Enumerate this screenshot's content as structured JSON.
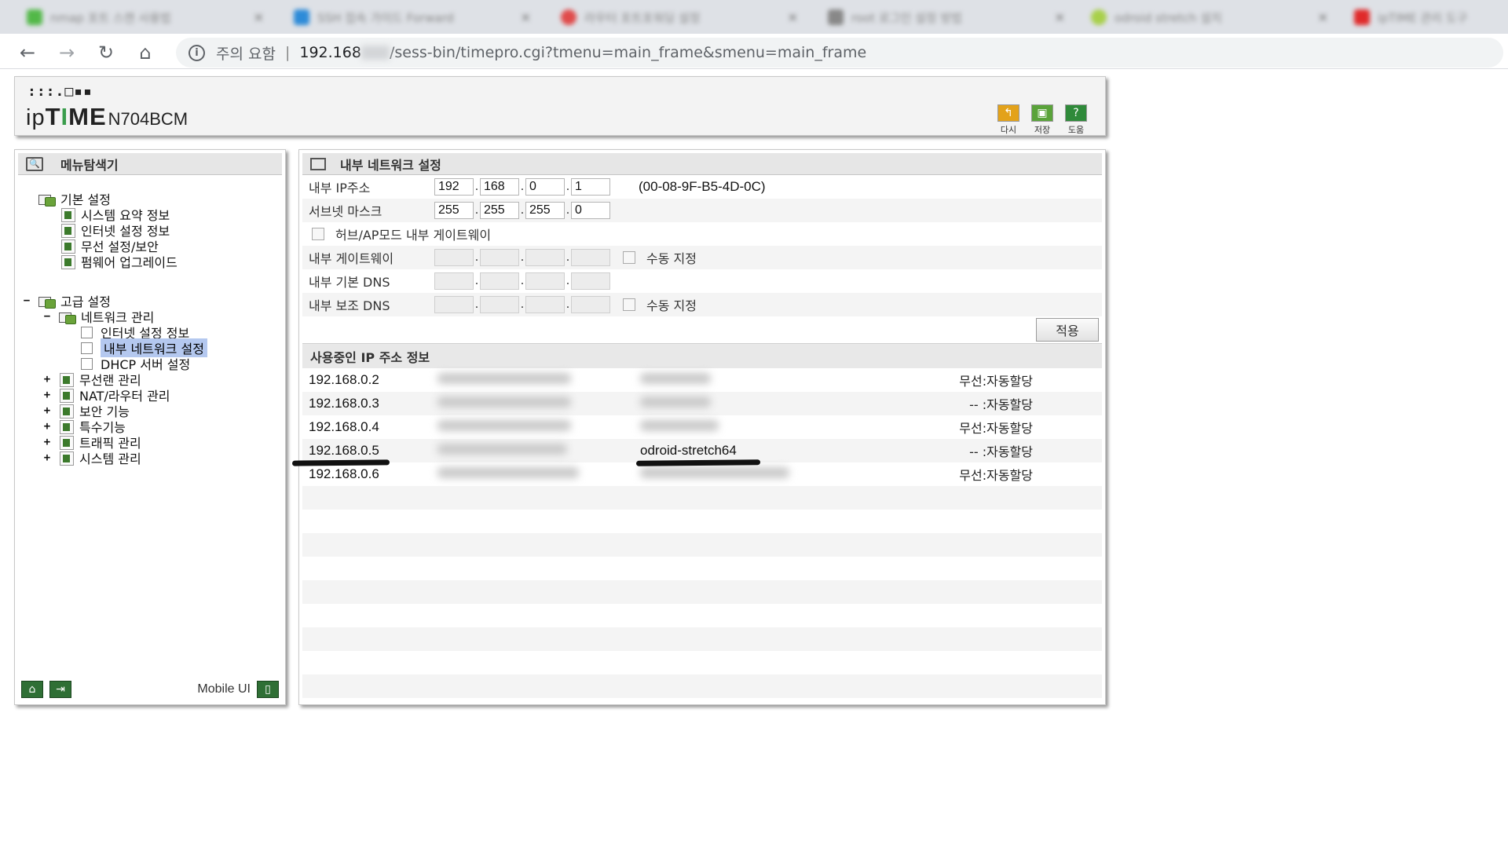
{
  "browser": {
    "tabs": [
      {
        "label": "nmap 포트 스캔 사용법",
        "color": "#52b848"
      },
      {
        "label": "SSH 접속 가이드 Forward",
        "color": "#2d8bd8"
      },
      {
        "label": "라우터 포트포워딩 설정",
        "color": "#e04b4b"
      },
      {
        "label": "root 로그인 설정 방법",
        "color": "#888888"
      },
      {
        "label": "odroid stretch 설치",
        "color": "#a8d04a"
      },
      {
        "label": "ipTIME 관리 도구",
        "color": "#e02a2a"
      }
    ],
    "security_label": "주의 요함",
    "url_host": "192.168",
    "url_path": "/sess-bin/timepro.cgi?tmenu=main_frame&smenu=main_frame"
  },
  "header": {
    "logo_dots": ":::.□▪▪",
    "logo_ip": "ip",
    "logo_time_a": "T",
    "logo_time_b": "I",
    "logo_time_c": "ME",
    "logo_model": "N704BCM",
    "buttons": [
      {
        "label": "다시",
        "icon": "undo-icon",
        "color": "#e3a21a"
      },
      {
        "label": "저장",
        "icon": "save-icon",
        "color": "#5aa33a"
      },
      {
        "label": "도움",
        "icon": "help-icon",
        "color": "#2f8a3a"
      }
    ]
  },
  "menu": {
    "title": "메뉴탐색기",
    "basic": {
      "title": "기본 설정",
      "items": [
        "시스템 요약 정보",
        "인터넷 설정 정보",
        "무선 설정/보안",
        "펌웨어 업그레이드"
      ]
    },
    "advanced": {
      "title": "고급 설정",
      "network": "네트워크 관리",
      "network_items": [
        "인터넷 설정 정보",
        "내부 네트워크 설정",
        "DHCP 서버 설정"
      ],
      "others": [
        "무선랜 관리",
        "NAT/라우터 관리",
        "보안 기능",
        "특수기능",
        "트래픽 관리",
        "시스템 관리"
      ]
    },
    "mobile_label": "Mobile UI"
  },
  "content": {
    "title": "내부 네트워크 설정",
    "ip_label": "내부 IP주소",
    "ip": [
      "192",
      "168",
      "0",
      "1"
    ],
    "mac": "(00-08-9F-B5-4D-0C)",
    "subnet_label": "서브넷 마스크",
    "subnet": [
      "255",
      "255",
      "255",
      "0"
    ],
    "hub_label": "허브/AP모드 내부 게이트웨이",
    "gateway_label": "내부 게이트웨이",
    "manual_label": "수동 지정",
    "dns1_label": "내부 기본 DNS",
    "dns2_label": "내부 보조 DNS",
    "apply_label": "적용",
    "leases_title": "사용중인 IP 주소 정보",
    "leases": [
      {
        "ip": "192.168.0.2",
        "host": "",
        "type": "무선:자동할당"
      },
      {
        "ip": "192.168.0.3",
        "host": "",
        "type": "-- :자동할당"
      },
      {
        "ip": "192.168.0.4",
        "host": "",
        "type": "무선:자동할당"
      },
      {
        "ip": "192.168.0.5",
        "host": "odroid-stretch64",
        "type": "-- :자동할당"
      },
      {
        "ip": "192.168.0.6",
        "host": "",
        "type": "무선:자동할당"
      }
    ]
  }
}
